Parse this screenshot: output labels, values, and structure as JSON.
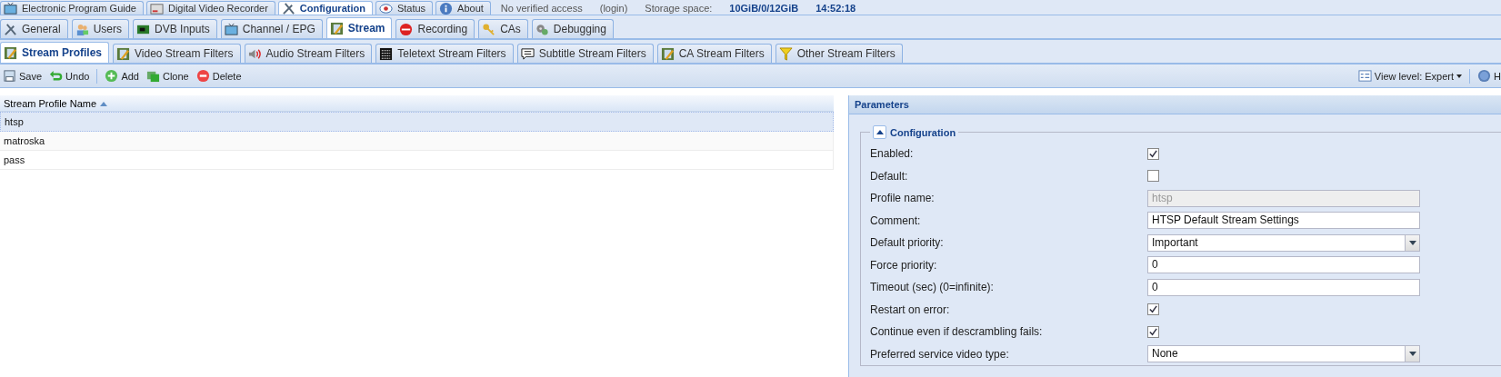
{
  "top_tabs": [
    {
      "label": "Electronic Program Guide",
      "selected": false
    },
    {
      "label": "Digital Video Recorder",
      "selected": false
    },
    {
      "label": "Configuration",
      "selected": true
    },
    {
      "label": "Status",
      "selected": false
    },
    {
      "label": "About",
      "selected": false
    }
  ],
  "status": {
    "access": "No verified access",
    "login": "(login)",
    "storage_label": "Storage space:",
    "storage_value": "10GiB/0/12GiB",
    "time": "14:52:18"
  },
  "config_tabs": [
    {
      "label": "General",
      "selected": false
    },
    {
      "label": "Users",
      "selected": false
    },
    {
      "label": "DVB Inputs",
      "selected": false
    },
    {
      "label": "Channel / EPG",
      "selected": false
    },
    {
      "label": "Stream",
      "selected": true
    },
    {
      "label": "Recording",
      "selected": false
    },
    {
      "label": "CAs",
      "selected": false
    },
    {
      "label": "Debugging",
      "selected": false
    }
  ],
  "stream_tabs": [
    {
      "label": "Stream Profiles",
      "selected": true
    },
    {
      "label": "Video Stream Filters",
      "selected": false
    },
    {
      "label": "Audio Stream Filters",
      "selected": false
    },
    {
      "label": "Teletext Stream Filters",
      "selected": false
    },
    {
      "label": "Subtitle Stream Filters",
      "selected": false
    },
    {
      "label": "CA Stream Filters",
      "selected": false
    },
    {
      "label": "Other Stream Filters",
      "selected": false
    }
  ],
  "toolbar": {
    "buttons": [
      {
        "label": "Save"
      },
      {
        "label": "Undo"
      },
      {
        "label": "Add"
      },
      {
        "label": "Clone"
      },
      {
        "label": "Delete"
      }
    ],
    "view_level": "View level: Expert",
    "help": "H"
  },
  "grid": {
    "column": "Stream Profile Name",
    "sort_ascending": true,
    "rows": [
      {
        "name": "htsp",
        "selected": true
      },
      {
        "name": "matroska",
        "selected": false
      },
      {
        "name": "pass",
        "selected": false
      }
    ]
  },
  "parameters": {
    "title": "Parameters",
    "section": {
      "title": "Configuration",
      "expanded": true
    },
    "fields": [
      {
        "kind": "checkbox",
        "label": "Enabled:",
        "checked": true
      },
      {
        "kind": "checkbox",
        "label": "Default:",
        "checked": false
      },
      {
        "kind": "text",
        "label": "Profile name:",
        "value": "htsp",
        "disabled": true
      },
      {
        "kind": "text",
        "label": "Comment:",
        "value": "HTSP Default Stream Settings",
        "disabled": false
      },
      {
        "kind": "select",
        "label": "Default priority:",
        "value": "Important"
      },
      {
        "kind": "text",
        "label": "Force priority:",
        "value": "0",
        "disabled": false
      },
      {
        "kind": "text",
        "label": "Timeout (sec) (0=infinite):",
        "value": "0",
        "disabled": false
      },
      {
        "kind": "checkbox",
        "label": "Restart on error:",
        "checked": true
      },
      {
        "kind": "checkbox",
        "label": "Continue even if descrambling fails:",
        "checked": true
      },
      {
        "kind": "select",
        "label": "Preferred service video type:",
        "value": "None"
      }
    ]
  }
}
